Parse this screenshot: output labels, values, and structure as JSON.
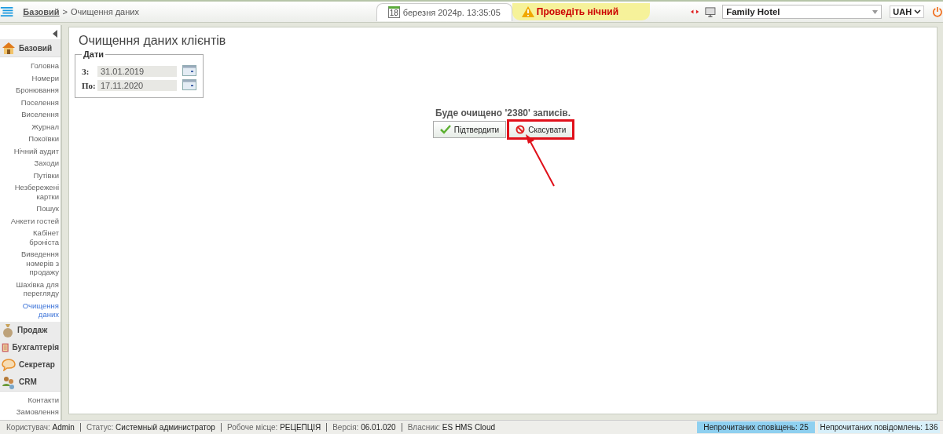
{
  "breadcrumb": {
    "root": "Базовий",
    "separator": ">",
    "current": "Очищення даних"
  },
  "topbar": {
    "date_day": "18",
    "date_text": "березня 2024р.  13:35:05",
    "alert": "Проведіть нічний",
    "hotel": "Family Hotel",
    "currency": "UAH"
  },
  "sidebar": {
    "sections": [
      {
        "label": "Базовий",
        "expanded": true,
        "items": [
          {
            "label": "Головна",
            "selected": false
          },
          {
            "label": "Номери",
            "selected": false
          },
          {
            "label": "Бронювання",
            "selected": false
          },
          {
            "label": "Поселення",
            "selected": false
          },
          {
            "label": "Виселення",
            "selected": false
          },
          {
            "label": "Журнал",
            "selected": false
          },
          {
            "label": "Покоївки",
            "selected": false
          },
          {
            "label": "Нічний аудит",
            "selected": false
          },
          {
            "label": "Заходи",
            "selected": false
          },
          {
            "label": "Путівки",
            "selected": false
          },
          {
            "label": "Незбережені картки",
            "selected": false
          },
          {
            "label": "Пошук",
            "selected": false
          },
          {
            "label": "Анкети гостей",
            "selected": false
          },
          {
            "label": "Кабінет броніста",
            "selected": false
          },
          {
            "label": "Виведення номерів з продажу",
            "selected": false
          },
          {
            "label": "Шахівка для перегляду",
            "selected": false
          },
          {
            "label": "Очищення даних",
            "selected": true
          }
        ]
      },
      {
        "label": "Продаж",
        "expanded": false
      },
      {
        "label": "Бухгалтерія",
        "expanded": false
      },
      {
        "label": "Секретар",
        "expanded": false
      },
      {
        "label": "CRM",
        "expanded": true,
        "items": [
          {
            "label": "Контакти",
            "selected": false
          },
          {
            "label": "Замовлення",
            "selected": false
          }
        ]
      }
    ]
  },
  "page": {
    "title": "Очищення даних клієнтів",
    "dates_legend": "Дати",
    "fields": [
      {
        "label": "З:",
        "value": "31.01.2019"
      },
      {
        "label": "По:",
        "value": "17.11.2020"
      }
    ],
    "message": "Буде очищено '2380' записів.",
    "buttons": [
      {
        "label": "Підтвердити",
        "kind": "confirm",
        "highlighted": false
      },
      {
        "label": "Скасувати",
        "kind": "cancel",
        "highlighted": true
      }
    ]
  },
  "status_bar": {
    "items": [
      {
        "label": "Користувач:",
        "value": "Admin"
      },
      {
        "label": "Статус:",
        "value": "Системный администратор"
      },
      {
        "label": "Робоче місце:",
        "value": "РЕЦЕПЦІЯ"
      },
      {
        "label": "Версія:",
        "value": "06.01.020"
      },
      {
        "label": "Власник:",
        "value": "ES HMS Cloud"
      }
    ],
    "notices": [
      {
        "text": "Непрочитаних сповіщень: 25",
        "kind": "alerts"
      },
      {
        "text": "Непрочитаних повідомлень: 136",
        "kind": "messages"
      }
    ]
  }
}
